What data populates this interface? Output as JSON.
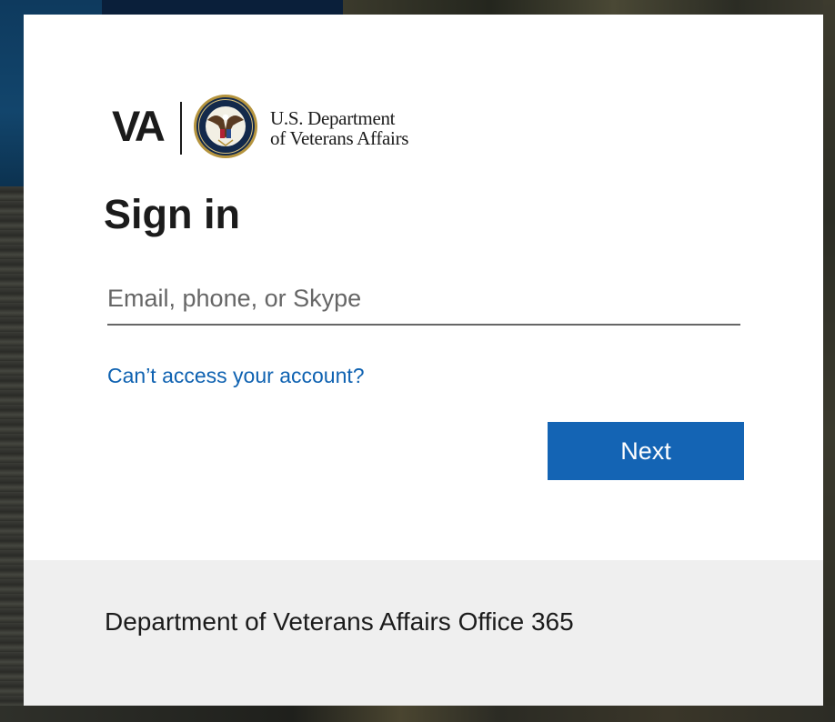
{
  "brand": {
    "logo_mark": "VA",
    "department_line1": "U.S. Department",
    "department_line2": "of Veterans Affairs",
    "seal_icon": "va-seal-icon"
  },
  "signin": {
    "title": "Sign in",
    "email_placeholder": "Email, phone, or Skype",
    "email_value": "",
    "help_link": "Can’t access your account?",
    "next_label": "Next"
  },
  "footer": {
    "text": "Department of Veterans Affairs Office 365"
  },
  "colors": {
    "accent": "#1464b4",
    "link": "#0f62b1",
    "footer_bg": "#efefef",
    "text": "#1b1b1b"
  }
}
